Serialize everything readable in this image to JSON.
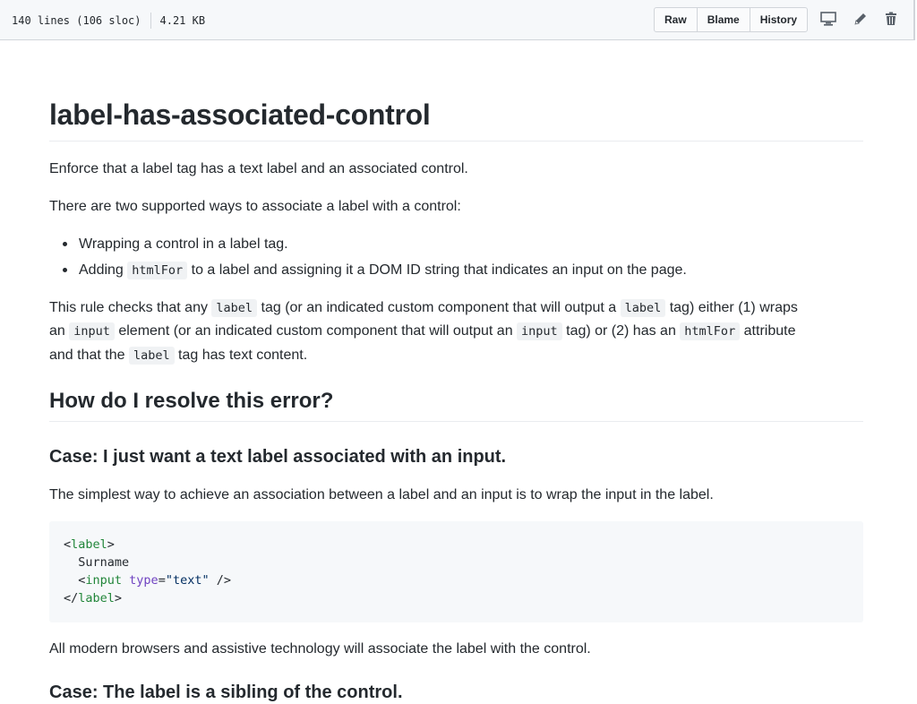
{
  "file_header": {
    "lines": "140 lines (106 sloc)",
    "size": "4.21 KB",
    "buttons": [
      "Raw",
      "Blame",
      "History"
    ],
    "icons": [
      "desktop-icon",
      "pencil-icon",
      "trash-icon"
    ]
  },
  "doc": {
    "title": "label-has-associated-control",
    "intro": "Enforce that a label tag has a text label and an associated control.",
    "two_ways": "There are two supported ways to associate a label with a control:",
    "bullets": {
      "b1": "Wrapping a control in a label tag.",
      "b2_pre": "Adding ",
      "b2_code": "htmlFor",
      "b2_post": " to a label and assigning it a DOM ID string that indicates an input on the page."
    },
    "rule_para": {
      "t1": "This rule checks that any ",
      "c1": "label",
      "t2": " tag (or an indicated custom component that will output a ",
      "c2": "label",
      "t3": " tag) either (1) wraps",
      "t4": "an ",
      "c3": "input",
      "t5": " element (or an indicated custom component that will output an ",
      "c4": "input",
      "t6": " tag) or (2) has an ",
      "c5": "htmlFor",
      "t7": " attribute",
      "t8": "and that the ",
      "c6": "label",
      "t9": " tag has text content."
    },
    "h2_resolve": "How do I resolve this error?",
    "h3_case1": "Case: I just want a text label associated with an input.",
    "case1_para": "The simplest way to achieve an association between a label and an input is to wrap the input in the label.",
    "code": {
      "l1_open": "<",
      "l1_tag": "label",
      "l1_close": ">",
      "l2_text": "  Surname",
      "l3_indent": "  <",
      "l3_tag": "input",
      "l3_attr": "type",
      "l3_eq": "=",
      "l3_val": "\"text\"",
      "l3_close": " />",
      "l4_open": "</",
      "l4_tag": "label",
      "l4_close": ">"
    },
    "after_code": "All modern browsers and assistive technology will associate the label with the control.",
    "h3_case2": "Case: The label is a sibling of the control."
  }
}
